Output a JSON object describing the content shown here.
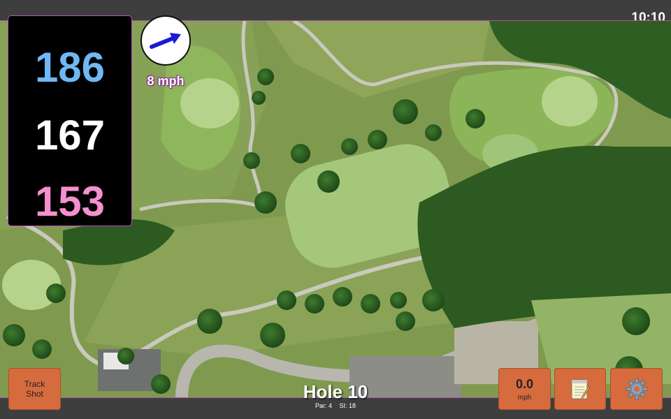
{
  "status": {
    "time": "10:10"
  },
  "distances": {
    "back": "186",
    "middle": "167",
    "front": "153"
  },
  "wind": {
    "speed_label": "8 mph",
    "direction_icon": "wind-arrow-icon",
    "arrow_color": "#1a1ad6"
  },
  "hole": {
    "title": "Hole 10",
    "par": "Par: 4",
    "stroke_index": "SI: 18"
  },
  "buttons": {
    "track_shot_line1": "Track",
    "track_shot_line2": "Shot",
    "wind_value": "0.0",
    "wind_unit": "mph",
    "notes_icon": "notepad-icon",
    "settings_icon": "gear-icon"
  },
  "colors": {
    "back_distance": "#6fb8f4",
    "middle_distance": "#ffffff",
    "front_distance": "#f58fcf",
    "button": "#d66b3d",
    "panel_border": "#c24ec3"
  }
}
